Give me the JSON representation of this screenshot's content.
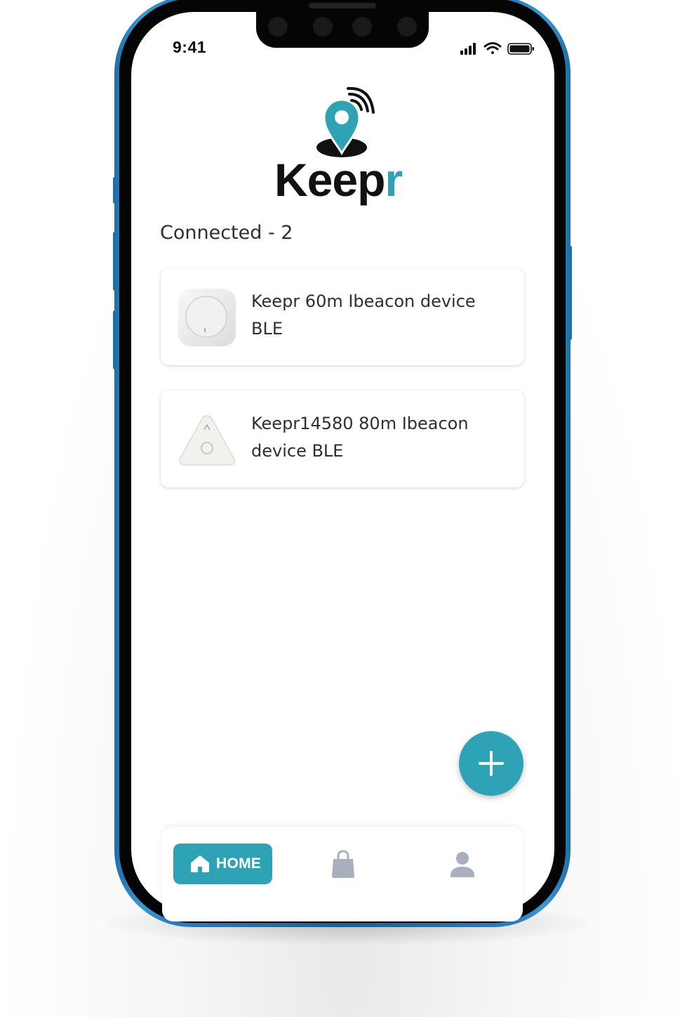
{
  "status_bar": {
    "time": "9:41",
    "signal_icon": "cellular-signal-icon",
    "wifi_icon": "wifi-icon",
    "battery_icon": "battery-icon"
  },
  "brand": {
    "logo_icon": "location-pin-signal-icon",
    "name_main": "Kee",
    "name_mid": "p",
    "name_accent": "r",
    "accent_color": "#2ea3b5",
    "text_color": "#111111"
  },
  "connected": {
    "title": "Connected - 2",
    "devices": [
      {
        "name": "Keepr 60m Ibeacon device BLE",
        "thumb_icon": "round-beacon-icon"
      },
      {
        "name": "Keepr14580 80m Ibeacon device BLE",
        "thumb_icon": "triangle-beacon-icon"
      }
    ]
  },
  "fab": {
    "icon": "plus-icon"
  },
  "nav": {
    "home_label": "HOME",
    "home_icon": "home-icon",
    "shop_icon": "shopping-bag-icon",
    "profile_icon": "user-icon",
    "active_color": "#2ea3b5",
    "inactive_color": "#a9afbd"
  }
}
